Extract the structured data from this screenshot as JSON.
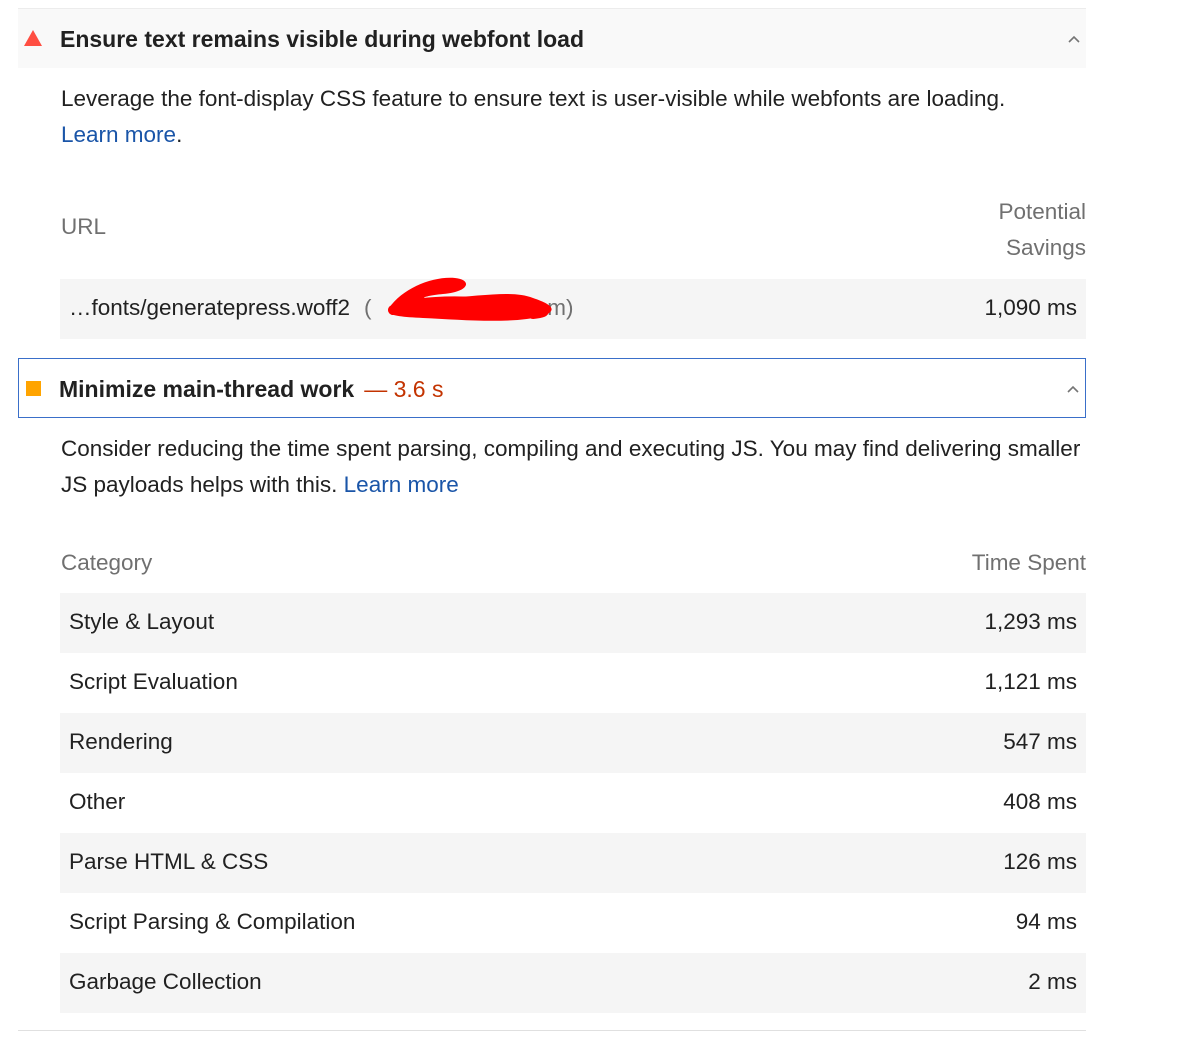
{
  "audits": [
    {
      "title": "Ensure text remains visible during webfont load",
      "status_icon": "fail-triangle-icon",
      "description": "Leverage the font-display CSS feature to ensure text is user-visible while webfonts are loading.",
      "learn_more": "Learn more",
      "learn_more_suffix": ".",
      "table": {
        "headers": [
          "URL",
          "Potential Savings"
        ],
        "rows": [
          {
            "url": "…fonts/generatepress.woff2",
            "host": "(",
            "host_suffix": "com)",
            "value": "1,090 ms"
          }
        ]
      }
    },
    {
      "title": "Minimize main-thread work",
      "display_value": "— 3.6 s",
      "status_icon": "average-square-icon",
      "description": "Consider reducing the time spent parsing, compiling and executing JS. You may find delivering smaller JS payloads helps with this.",
      "learn_more": "Learn more",
      "table": {
        "headers": [
          "Category",
          "Time Spent"
        ],
        "rows": [
          {
            "label": "Style & Layout",
            "value": "1,293 ms"
          },
          {
            "label": "Script Evaluation",
            "value": "1,121 ms"
          },
          {
            "label": "Rendering",
            "value": "547 ms"
          },
          {
            "label": "Other",
            "value": "408 ms"
          },
          {
            "label": "Parse HTML & CSS",
            "value": "126 ms"
          },
          {
            "label": "Script Parsing & Compilation",
            "value": "94 ms"
          },
          {
            "label": "Garbage Collection",
            "value": "2 ms"
          }
        ]
      }
    }
  ],
  "colors": {
    "fail": "#ff4e42",
    "average": "#ffa400",
    "display_value": "#c33300",
    "link": "#1a55a8",
    "focus_border": "#3a6fc9",
    "redaction_mark": "#ff0000"
  }
}
